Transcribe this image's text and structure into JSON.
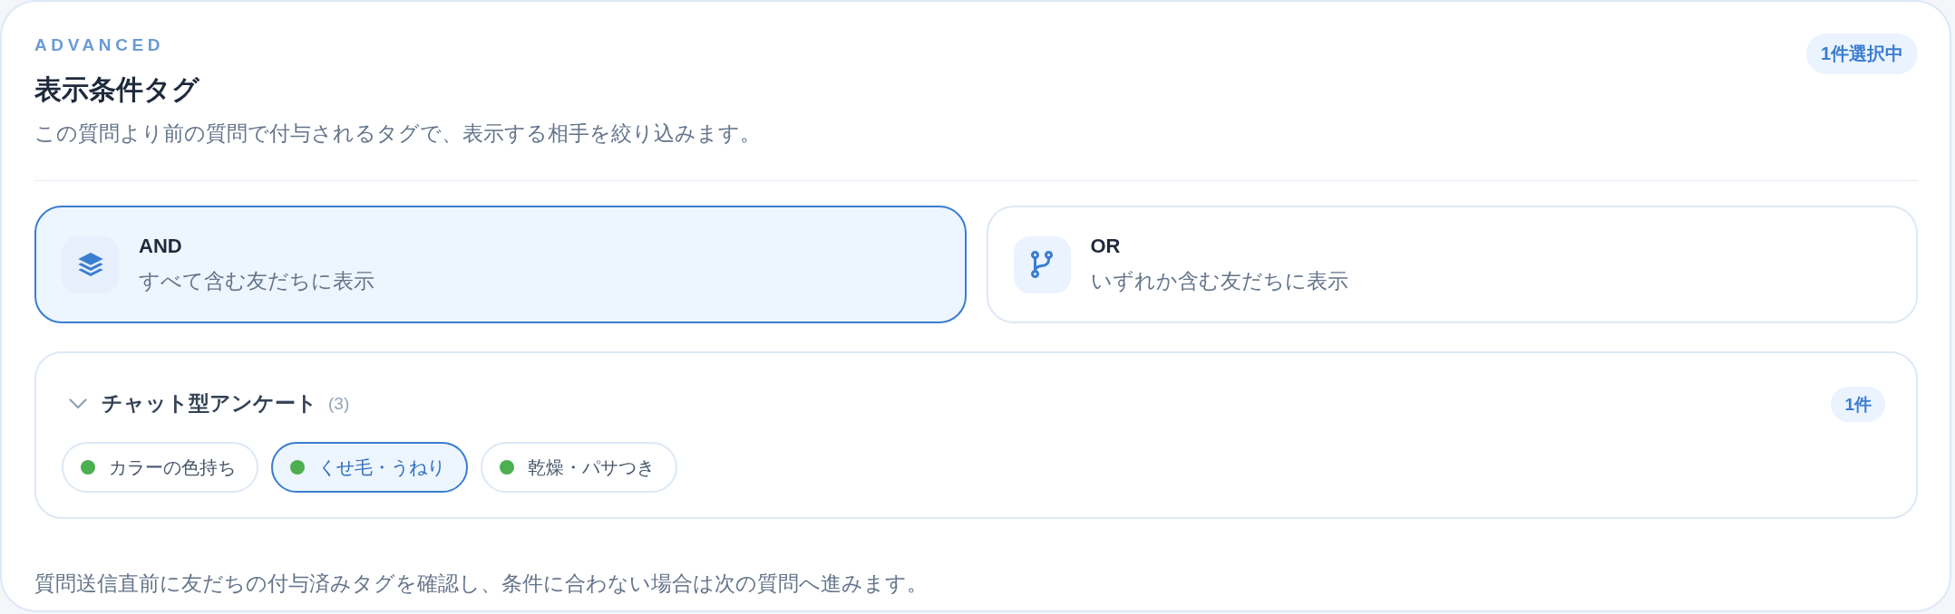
{
  "header": {
    "eyebrow": "ADVANCED",
    "title": "表示条件タグ",
    "description": "この質問より前の質問で付与されるタグで、表示する相手を絞り込みます。",
    "badge": "1件選択中"
  },
  "modes": [
    {
      "kind": "and",
      "label": "AND",
      "description": "すべて含む友だちに表示",
      "selected": true
    },
    {
      "kind": "or",
      "label": "OR",
      "description": "いずれか含む友だちに表示",
      "selected": false
    }
  ],
  "tag_group": {
    "title": "チャット型アンケート",
    "count": "(3)",
    "expanded": true,
    "badge": "1件",
    "tags": [
      {
        "label": "カラーの色持ち",
        "color": "#4caf50",
        "selected": false
      },
      {
        "label": "くせ毛・うねり",
        "color": "#4caf50",
        "selected": true
      },
      {
        "label": "乾燥・パサつき",
        "color": "#4caf50",
        "selected": false
      }
    ]
  },
  "note": "質問送信直前に友だちの付与済みタグを確認し、条件に合わない場合は次の質問へ進みます。"
}
